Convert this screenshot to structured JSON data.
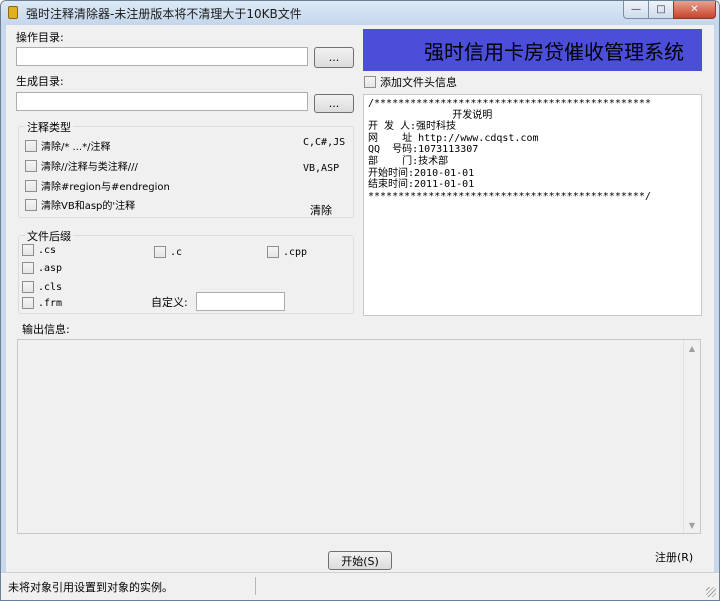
{
  "window": {
    "title": "强时注释清除器-未注册版本将不清理大于10KB文件",
    "min_glyph": "—",
    "max_glyph": "□",
    "close_glyph": "✕"
  },
  "source_dir": {
    "label": "操作目录:",
    "value": "",
    "browse_label": "..."
  },
  "output_dir": {
    "label": "生成目录:",
    "value": "",
    "browse_label": "..."
  },
  "comment_types": {
    "title": "注释类型",
    "items": [
      {
        "label": "清除/* ...*/注释",
        "checked": false
      },
      {
        "label": "清除//注释与类注释///",
        "checked": false
      },
      {
        "label": "清除#region与#endregion",
        "checked": false
      },
      {
        "label": "清除VB和asp的'注释",
        "checked": false
      }
    ],
    "hint_c": "C,C#,JS",
    "hint_vb": "VB,ASP",
    "clear_label": "清除"
  },
  "file_ext": {
    "title": "文件后缀",
    "items": [
      ".cs",
      ".c",
      ".cpp",
      ".asp",
      ".cls",
      ".frm"
    ],
    "custom_label": "自定义:",
    "custom_value": ""
  },
  "banner": {
    "text": "强时信用卡房贷催收管理系统",
    "bg": "#4a4ed8"
  },
  "add_header": {
    "label": "添加文件头信息",
    "checked": false
  },
  "preview_lines": [
    "/**********************************************",
    "              开发说明",
    "",
    "开 发 人:强时科技",
    "网    址 http://www.cdqst.com",
    "QQ  号码:1073113307",
    "部    门:技术部",
    "开始时间:2010-01-01",
    "结束时间:2011-01-01",
    "**********************************************/"
  ],
  "output": {
    "label": "输出信息:",
    "scroll_up": "▲",
    "scroll_down": "▼"
  },
  "actions": {
    "start_label": "开始(S)",
    "register_label": "注册(R)"
  },
  "status": {
    "text": "未将对象引用设置到对象的实例。"
  }
}
